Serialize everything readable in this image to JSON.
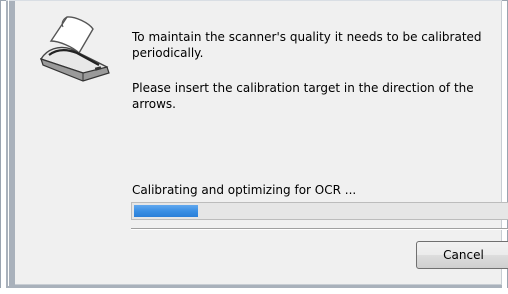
{
  "dialog": {
    "message_1": "To maintain the scanner's quality it needs to be calibrated periodically.",
    "message_2": "Please insert the calibration target in the direction of the arrows.",
    "status_text": "Calibrating and optimizing for OCR ...",
    "progress_fraction": 0.17,
    "progress_color": "#3a8fe4",
    "cancel_label": "Cancel",
    "icon": "scanner-icon"
  }
}
